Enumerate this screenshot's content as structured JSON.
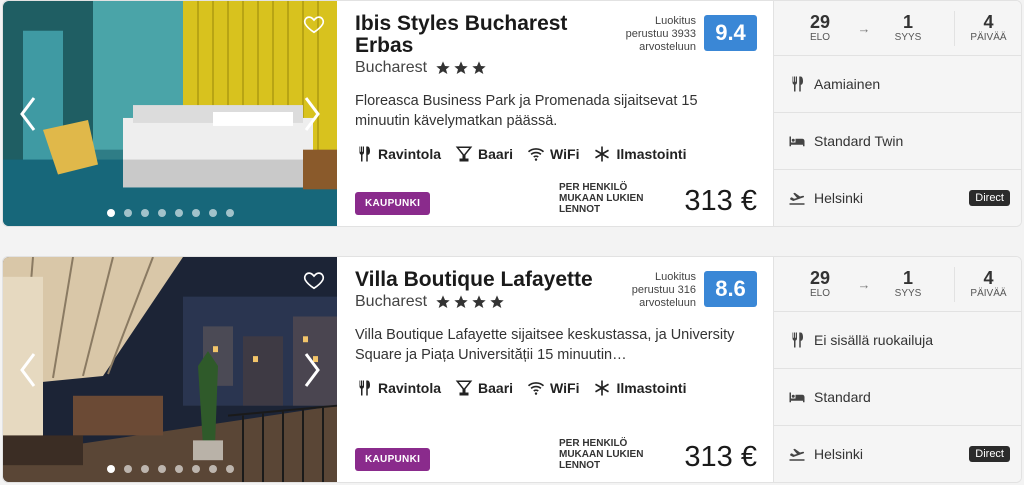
{
  "hotels": [
    {
      "name": "Ibis Styles Bucharest Erbas",
      "city": "Bucharest",
      "stars": 3,
      "rating_text": "Luokitus perustuu 3933 arvosteluun",
      "score": "9.4",
      "description": "Floreasca Business Park ja Promenada sijaitsevat 15 minuutin kävelymatkan päässä.",
      "amenities": [
        "Ravintola",
        "Baari",
        "WiFi",
        "Ilmastointi"
      ],
      "category": "KAUPUNKI",
      "price_label": "PER HENKILÖ MUKAAN LUKIEN LENNOT",
      "price": "313 €",
      "photo_dots": 8,
      "active_dot": 0,
      "dates": {
        "start_day": "29",
        "start_month": "ELO",
        "end_day": "1",
        "end_month": "SYYS",
        "nights": "4",
        "nights_label": "PÄIVÄÄ"
      },
      "board": "Aamiainen",
      "room": "Standard Twin",
      "departure": "Helsinki",
      "flight_type": "Direct"
    },
    {
      "name": "Villa Boutique Lafayette",
      "city": "Bucharest",
      "stars": 4,
      "rating_text": "Luokitus perustuu 316 arvosteluun",
      "score": "8.6",
      "description": "Villa Boutique Lafayette sijaitsee keskustassa, ja University Square ja Piața Universității 15 minuutin…",
      "amenities": [
        "Ravintola",
        "Baari",
        "WiFi",
        "Ilmastointi"
      ],
      "category": "KAUPUNKI",
      "price_label": "PER HENKILÖ MUKAAN LUKIEN LENNOT",
      "price": "313 €",
      "photo_dots": 8,
      "active_dot": 0,
      "dates": {
        "start_day": "29",
        "start_month": "ELO",
        "end_day": "1",
        "end_month": "SYYS",
        "nights": "4",
        "nights_label": "PÄIVÄÄ"
      },
      "board": "Ei sisällä ruokailuja",
      "room": "Standard",
      "departure": "Helsinki",
      "flight_type": "Direct"
    }
  ],
  "icons": {
    "amenities": [
      "restaurant-icon",
      "bar-icon",
      "wifi-icon",
      "snowflake-icon"
    ],
    "board": "fork-knife-icon",
    "room": "bed-icon",
    "departure": "plane-icon"
  },
  "colors": {
    "score_bg": "#3a87d6",
    "category_badge": "#8a2b8c",
    "direct_badge": "#2b2b2b"
  }
}
